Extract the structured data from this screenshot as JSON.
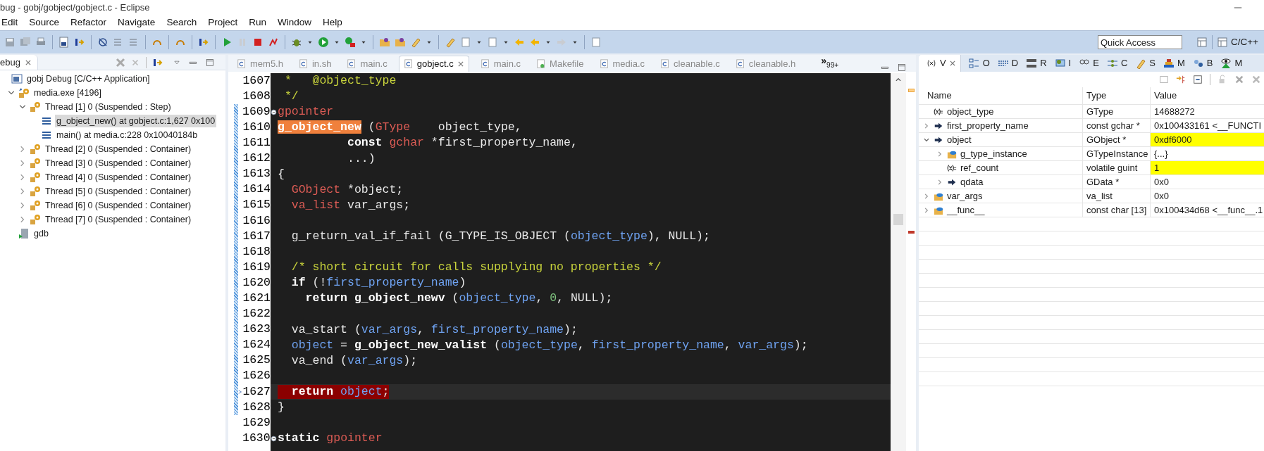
{
  "window": {
    "title": "bug - gobj/gobject/gobject.c - Eclipse"
  },
  "menu": [
    "Edit",
    "Source",
    "Refactor",
    "Navigate",
    "Search",
    "Project",
    "Run",
    "Window",
    "Help"
  ],
  "quick_access": {
    "placeholder": "Quick Access"
  },
  "perspective": {
    "label": "C/C++"
  },
  "debug_view": {
    "tab": "ebug",
    "tree": [
      {
        "label": "gobj Debug [C/C++ Application]",
        "kind": "launch",
        "selected": false,
        "children": [
          {
            "label": "media.exe [4196]",
            "kind": "process",
            "expanded": true,
            "selected": false,
            "children": [
              {
                "label": "Thread [1] 0 (Suspended : Step)",
                "kind": "thread",
                "expanded": true,
                "selected": false,
                "children": [
                  {
                    "label": "g_object_new() at gobject.c:1,627 0x100",
                    "kind": "frame",
                    "selected": true
                  },
                  {
                    "label": "main() at media.c:228 0x10040184b",
                    "kind": "frame",
                    "selected": false
                  }
                ]
              },
              {
                "label": "Thread [2] 0 (Suspended : Container)",
                "kind": "thread",
                "expanded": false,
                "selected": false
              },
              {
                "label": "Thread [3] 0 (Suspended : Container)",
                "kind": "thread",
                "expanded": false,
                "selected": false
              },
              {
                "label": "Thread [4] 0 (Suspended : Container)",
                "kind": "thread",
                "expanded": false,
                "selected": false
              },
              {
                "label": "Thread [5] 0 (Suspended : Container)",
                "kind": "thread",
                "expanded": false,
                "selected": false
              },
              {
                "label": "Thread [6] 0 (Suspended : Container)",
                "kind": "thread",
                "expanded": false,
                "selected": false
              },
              {
                "label": "Thread [7] 0 (Suspended : Container)",
                "kind": "thread",
                "expanded": false,
                "selected": false
              }
            ]
          },
          {
            "label": "gdb",
            "kind": "debugger",
            "selected": false
          }
        ]
      }
    ]
  },
  "editor": {
    "tabs": [
      {
        "label": "mem5.h",
        "kind": "c",
        "selected": false
      },
      {
        "label": "in.sh",
        "kind": "c",
        "selected": false
      },
      {
        "label": "main.c",
        "kind": "c",
        "selected": false
      },
      {
        "label": "gobject.c",
        "kind": "c",
        "selected": true
      },
      {
        "label": "main.c",
        "kind": "c",
        "selected": false
      },
      {
        "label": "Makefile",
        "kind": "make",
        "selected": false
      },
      {
        "label": "media.c",
        "kind": "c",
        "selected": false
      },
      {
        "label": "cleanable.c",
        "kind": "c",
        "selected": false
      },
      {
        "label": "cleanable.h",
        "kind": "c",
        "selected": false
      }
    ],
    "overflow": {
      "glyph": "»",
      "count": "99+"
    },
    "lines": [
      {
        "number": "1607",
        "fold": false,
        "current": false,
        "tokens": [
          {
            "text": " *   @object_type",
            "kind": "comment"
          }
        ]
      },
      {
        "number": "1608",
        "fold": false,
        "current": false,
        "tokens": [
          {
            "text": " */",
            "kind": "comment"
          }
        ]
      },
      {
        "number": "1609",
        "fold": true,
        "current": false,
        "tokens": [
          {
            "text": "gpointer",
            "kind": "type"
          }
        ]
      },
      {
        "number": "1610",
        "fold": false,
        "current": false,
        "tokens": [
          {
            "text": "g_object_new",
            "kind": "match"
          },
          {
            "text": " (",
            "kind": "plain"
          },
          {
            "text": "GType",
            "kind": "type"
          },
          {
            "text": "    object_type,",
            "kind": "plain"
          }
        ]
      },
      {
        "number": "1611",
        "fold": false,
        "current": false,
        "tokens": [
          {
            "text": "          const",
            "kind": "keyword"
          },
          {
            "text": " gchar",
            "kind": "type"
          },
          {
            "text": " *first_property_name,",
            "kind": "plain"
          }
        ]
      },
      {
        "number": "1612",
        "fold": false,
        "current": false,
        "tokens": [
          {
            "text": "          ...)",
            "kind": "plain"
          }
        ]
      },
      {
        "number": "1613",
        "fold": false,
        "current": false,
        "tokens": [
          {
            "text": "{",
            "kind": "plain"
          }
        ]
      },
      {
        "number": "1614",
        "fold": false,
        "current": false,
        "tokens": [
          {
            "text": "  GObject",
            "kind": "type"
          },
          {
            "text": " *object;",
            "kind": "plain"
          }
        ]
      },
      {
        "number": "1615",
        "fold": false,
        "current": false,
        "tokens": [
          {
            "text": "  va_list",
            "kind": "type"
          },
          {
            "text": " var_args;",
            "kind": "plain"
          }
        ]
      },
      {
        "number": "1616",
        "fold": false,
        "current": false
      },
      {
        "number": "1617",
        "fold": false,
        "current": false,
        "tokens": [
          {
            "text": "  g_return_val_if_fail (G_TYPE_IS_OBJECT (",
            "kind": "plain"
          },
          {
            "text": "object_type",
            "kind": "param"
          },
          {
            "text": "), NULL);",
            "kind": "plain"
          }
        ]
      },
      {
        "number": "1618",
        "fold": false,
        "current": false
      },
      {
        "number": "1619",
        "fold": false,
        "current": false,
        "tokens": [
          {
            "text": "  /* short circuit for calls supplying no properties */",
            "kind": "comment"
          }
        ]
      },
      {
        "number": "1620",
        "fold": false,
        "current": false,
        "tokens": [
          {
            "text": "  if",
            "kind": "keyword"
          },
          {
            "text": " (!",
            "kind": "plain"
          },
          {
            "text": "first_property_name",
            "kind": "param"
          },
          {
            "text": ")",
            "kind": "plain"
          }
        ]
      },
      {
        "number": "1621",
        "fold": false,
        "current": false,
        "tokens": [
          {
            "text": "    return g_object_newv",
            "kind": "keyword"
          },
          {
            "text": " (",
            "kind": "plain"
          },
          {
            "text": "object_type",
            "kind": "param"
          },
          {
            "text": ", ",
            "kind": "plain"
          },
          {
            "text": "0",
            "kind": "number"
          },
          {
            "text": ", NULL);",
            "kind": "plain"
          }
        ]
      },
      {
        "number": "1622",
        "fold": false,
        "current": false
      },
      {
        "number": "1623",
        "fold": false,
        "current": false,
        "tokens": [
          {
            "text": "  va_start (",
            "kind": "plain"
          },
          {
            "text": "var_args",
            "kind": "param"
          },
          {
            "text": ", ",
            "kind": "plain"
          },
          {
            "text": "first_property_name",
            "kind": "param"
          },
          {
            "text": ");",
            "kind": "plain"
          }
        ]
      },
      {
        "number": "1624",
        "fold": false,
        "current": false,
        "tokens": [
          {
            "text": "  object",
            "kind": "param"
          },
          {
            "text": " = ",
            "kind": "plain"
          },
          {
            "text": "g_object_new_valist",
            "kind": "keyword"
          },
          {
            "text": " (",
            "kind": "plain"
          },
          {
            "text": "object_type",
            "kind": "param"
          },
          {
            "text": ", ",
            "kind": "plain"
          },
          {
            "text": "first_property_name",
            "kind": "param"
          },
          {
            "text": ", ",
            "kind": "plain"
          },
          {
            "text": "var_args",
            "kind": "param"
          },
          {
            "text": ");",
            "kind": "plain"
          }
        ]
      },
      {
        "number": "1625",
        "fold": false,
        "current": false,
        "tokens": [
          {
            "text": "  va_end (",
            "kind": "plain"
          },
          {
            "text": "var_args",
            "kind": "param"
          },
          {
            "text": ");",
            "kind": "plain"
          }
        ]
      },
      {
        "number": "1626",
        "fold": false,
        "current": false
      },
      {
        "number": "1627",
        "fold": false,
        "current": true,
        "tokens": [
          {
            "text": "  return",
            "kind": "keyword"
          },
          {
            "text": " object",
            "kind": "param"
          },
          {
            "text": ";",
            "kind": "plain"
          }
        ]
      },
      {
        "number": "1628",
        "fold": false,
        "current": false,
        "tokens": [
          {
            "text": "}",
            "kind": "plain"
          }
        ]
      },
      {
        "number": "1629",
        "fold": false,
        "current": false
      },
      {
        "number": "1630",
        "fold": true,
        "current": false,
        "tokens": [
          {
            "text": "static",
            "kind": "keyword"
          },
          {
            "text": " gpointer",
            "kind": "type"
          }
        ]
      }
    ]
  },
  "right_tabs": [
    {
      "label": "V",
      "selected": true
    },
    {
      "label": "O",
      "selected": false
    },
    {
      "label": "D",
      "selected": false
    },
    {
      "label": "R",
      "selected": false
    },
    {
      "label": "I",
      "selected": false
    },
    {
      "label": "E",
      "selected": false
    },
    {
      "label": "C",
      "selected": false
    },
    {
      "label": "S",
      "selected": false
    },
    {
      "label": "M",
      "selected": false
    },
    {
      "label": "B",
      "selected": false
    },
    {
      "label": "M",
      "selected": false
    }
  ],
  "variables": {
    "columns": [
      "Name",
      "Type",
      "Value"
    ],
    "rows": [
      {
        "name": "object_type",
        "type": "GType",
        "value": "14688272",
        "kind": "scalar",
        "changed": false
      },
      {
        "name": "first_property_name",
        "type": "const gchar *",
        "value": "0x100433161 <__FUNCTI",
        "kind": "pointer",
        "expanded": false,
        "changed": false
      },
      {
        "name": "object",
        "type": "GObject *",
        "value": "0xdf6000",
        "kind": "pointer",
        "expanded": true,
        "changed": true,
        "children": [
          {
            "name": "g_type_instance",
            "type": "GTypeInstance",
            "value": "{...}",
            "kind": "struct",
            "expanded": false,
            "changed": false
          },
          {
            "name": "ref_count",
            "type": "volatile guint",
            "value": "1",
            "kind": "scalar",
            "changed": true
          },
          {
            "name": "qdata",
            "type": "GData *",
            "value": "0x0",
            "kind": "pointer",
            "expanded": false,
            "changed": false
          }
        ]
      },
      {
        "name": "var_args",
        "type": "va_list",
        "value": "0x0",
        "kind": "struct",
        "expanded": false,
        "changed": false
      },
      {
        "name": "__func__",
        "type": "const char [13]",
        "value": "0x100434d68 <__func__.1",
        "kind": "struct",
        "expanded": false,
        "changed": false
      }
    ]
  }
}
